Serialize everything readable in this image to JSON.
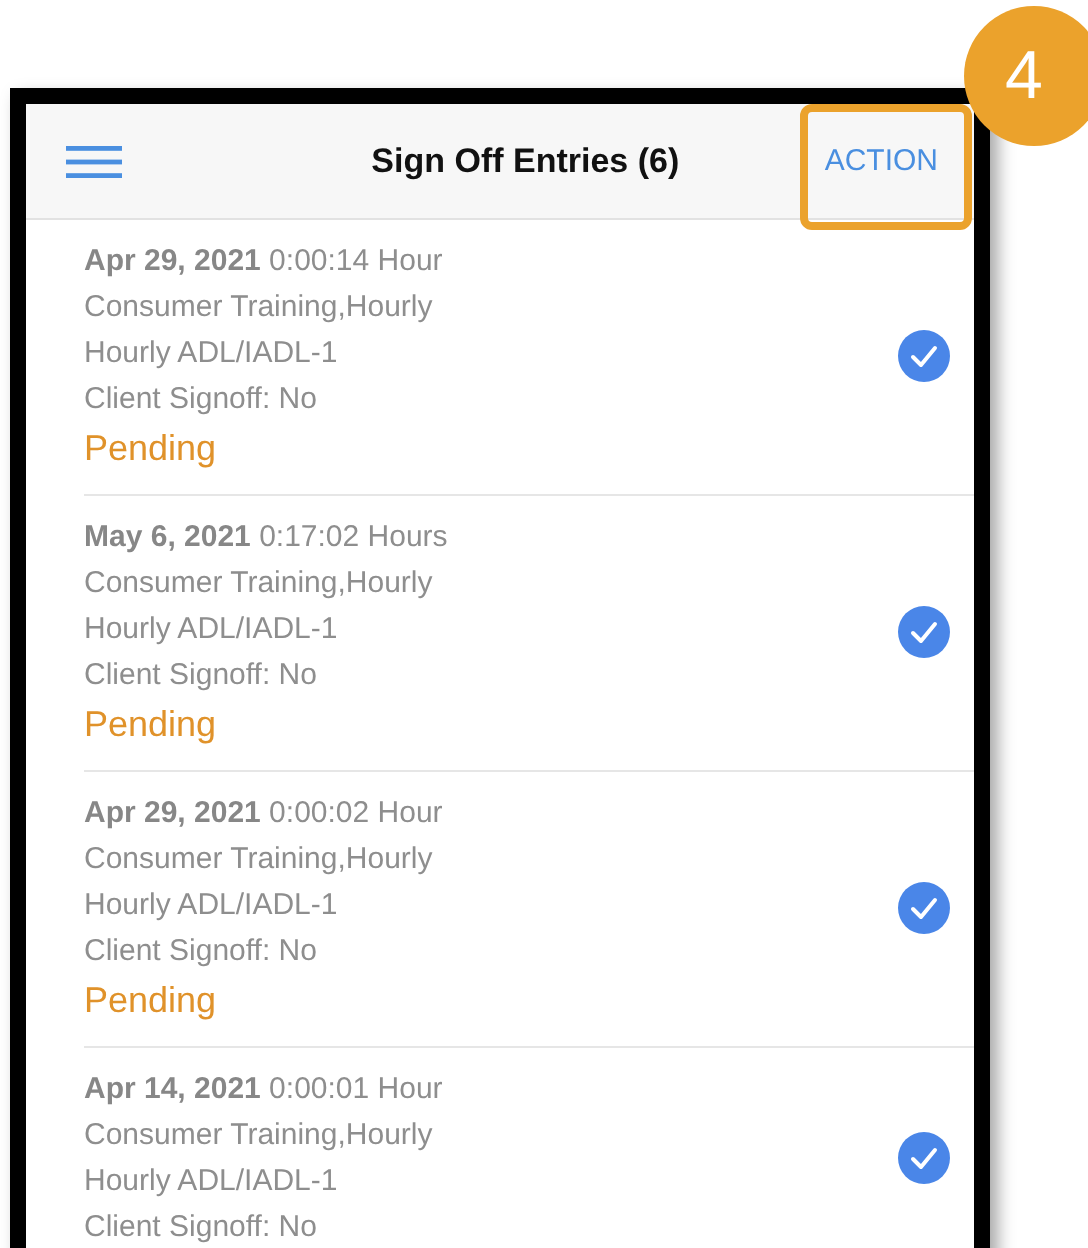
{
  "callout": {
    "number": "4"
  },
  "header": {
    "title": "Sign Off Entries (6)",
    "action": "ACTION"
  },
  "entries": [
    {
      "date": "Apr 29, 2021",
      "duration": "0:00:14 Hour",
      "service": "Consumer Training,Hourly",
      "activity": "Hourly ADL/IADL-1",
      "client_signoff": "Client Signoff: No",
      "status": "Pending",
      "checked": true
    },
    {
      "date": "May 6, 2021",
      "duration": "0:17:02 Hours",
      "service": "Consumer Training,Hourly",
      "activity": "Hourly ADL/IADL-1",
      "client_signoff": "Client Signoff: No",
      "status": "Pending",
      "checked": true
    },
    {
      "date": "Apr 29, 2021",
      "duration": "0:00:02 Hour",
      "service": "Consumer Training,Hourly",
      "activity": "Hourly ADL/IADL-1",
      "client_signoff": "Client Signoff: No",
      "status": "Pending",
      "checked": true
    },
    {
      "date": "Apr 14, 2021",
      "duration": "0:00:01 Hour",
      "service": "Consumer Training,Hourly",
      "activity": "Hourly ADL/IADL-1",
      "client_signoff": "Client Signoff: No",
      "checked": true
    }
  ]
}
